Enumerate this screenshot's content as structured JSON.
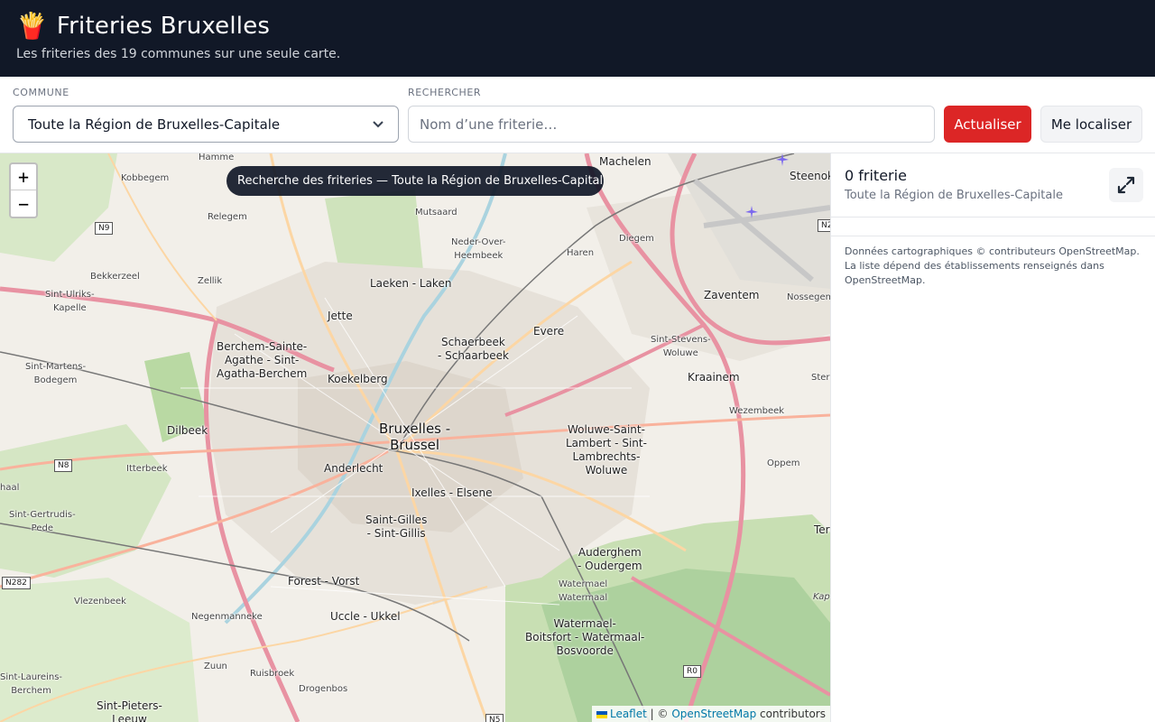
{
  "header": {
    "logo_emoji": "🍟",
    "title": "Friteries Bruxelles",
    "subtitle": "Les friteries des 19 communes sur une seule carte."
  },
  "controls": {
    "commune_label": "COMMUNE",
    "commune_selected": "Toute la Région de Bruxelles-Capitale",
    "search_label": "RECHERCHER",
    "search_placeholder": "Nom d’une friterie…",
    "search_value": "",
    "refresh_button": "Actualiser",
    "locate_button": "Me localiser"
  },
  "map": {
    "zoom_in": "+",
    "zoom_out": "−",
    "toast": "Recherche des friteries — Toute la Région de Bruxelles-Capitale…",
    "attribution": {
      "leaflet": "Leaflet",
      "separator": "| ©",
      "osm": "OpenStreetMap",
      "suffix": "contributors"
    },
    "place_labels": {
      "hamme": "Hamme",
      "kobbegem": "Kobbegem",
      "relegem": "Relegem",
      "mutsaard": "Mutsaard",
      "neder_over_heembeek": "Neder-Over-\nHeembeek",
      "machelen": "Machelen",
      "steenokkerzeel": "Steenok",
      "diegem": "Diegem",
      "haren": "Haren",
      "bekkerzeel": "Bekkerzeel",
      "zellik": "Zellik",
      "sint_ulriks_kapelle": "Sint-Ulriks-\nKapelle",
      "laeken": "Laeken - Laken",
      "jette": "Jette",
      "schaerbeek": "Schaerbeek\n- Schaarbeek",
      "evere": "Evere",
      "zaventem": "Zaventem",
      "nossegem": "Nossegem",
      "berchem": "Berchem-Sainte-\nAgathe - Sint-\nAgatha-Berchem",
      "sint_martens_bodegem": "Sint-Martens-\nBodegem",
      "koekelberg": "Koekelberg",
      "sint_stevens_woluwe": "Sint-Stevens-\nWoluwe",
      "kraainem": "Kraainem",
      "sterrebeek": "Stere",
      "bruxelles": "Bruxelles -\nBrussel",
      "wezembeek": "Wezembeek",
      "dilbeek": "Dilbeek",
      "woluwe_saint_lambert": "Woluwe-Saint-\nLambert - Sint-\nLambrechts-\nWoluwe",
      "itterbeek": "Itterbeek",
      "anderlecht": "Anderlecht",
      "oppem": "Oppem",
      "ixelles": "Ixelles - Elsene",
      "sint_gertrudis_pede": "Sint-Gertrudis-\nPede",
      "saint_gilles": "Saint-Gilles\n- Sint-Gillis",
      "tervuren": "Ter",
      "auderghem": "Auderghem\n- Oudergem",
      "forest": "Forest - Vorst",
      "watermael_small": "Watermael\nWatermaal",
      "vlezenbeek": "Vlezenbeek",
      "negenmanneke": "Negenmanneke",
      "uccle": "Uccle - Ukkel",
      "watermael_boitsfort": "Watermael-\nBoitsfort - Watermaal-\nBosvoorde",
      "zuun": "Zuun",
      "ruisbroek": "Ruisbroek",
      "drogenbos": "Drogenbos",
      "sint_laureins_berchem": "Sint-Laureins-\nBerchem",
      "sint_pieters_leeuw": "Sint-Pieters-\nLeeuw",
      "kapelle": "Kap",
      "haal": "haal"
    },
    "road_shields": {
      "n9": "N9",
      "n8": "N8",
      "n282": "N282",
      "n2": "N2",
      "r0": "R0",
      "n5": "N5"
    }
  },
  "sidebar": {
    "count": "0 friterie",
    "scope": "Toute la Région de Bruxelles-Capitale",
    "credits": "Données cartographiques © contributeurs OpenStreetMap. La liste dépend des établissements renseignés dans OpenStreetMap."
  }
}
